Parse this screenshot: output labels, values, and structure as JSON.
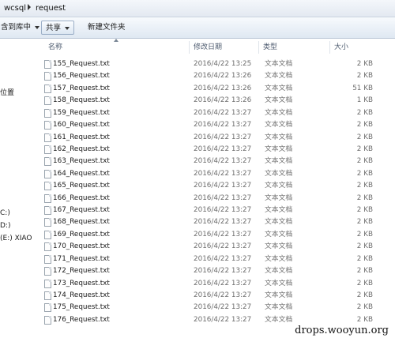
{
  "address": {
    "crumbs": [
      "wcsql",
      "request"
    ]
  },
  "toolbar": {
    "include_label": "含到库中",
    "share_label": "共享",
    "new_folder_label": "新建文件夹"
  },
  "nav": {
    "items": [
      "位置",
      "C:)",
      "D:)",
      "(E:) XIAO"
    ]
  },
  "columns": {
    "name": "名称",
    "date": "修改日期",
    "type": "类型",
    "size": "大小"
  },
  "files": [
    {
      "name": "155_Request.txt",
      "date": "2016/4/22 13:25",
      "type": "文本文档",
      "size": "2 KB"
    },
    {
      "name": "156_Request.txt",
      "date": "2016/4/22 13:26",
      "type": "文本文档",
      "size": "2 KB"
    },
    {
      "name": "157_Request.txt",
      "date": "2016/4/22 13:26",
      "type": "文本文档",
      "size": "51 KB"
    },
    {
      "name": "158_Request.txt",
      "date": "2016/4/22 13:26",
      "type": "文本文档",
      "size": "1 KB"
    },
    {
      "name": "159_Request.txt",
      "date": "2016/4/22 13:27",
      "type": "文本文档",
      "size": "2 KB"
    },
    {
      "name": "160_Request.txt",
      "date": "2016/4/22 13:27",
      "type": "文本文档",
      "size": "2 KB"
    },
    {
      "name": "161_Request.txt",
      "date": "2016/4/22 13:27",
      "type": "文本文档",
      "size": "2 KB"
    },
    {
      "name": "162_Request.txt",
      "date": "2016/4/22 13:27",
      "type": "文本文档",
      "size": "2 KB"
    },
    {
      "name": "163_Request.txt",
      "date": "2016/4/22 13:27",
      "type": "文本文档",
      "size": "2 KB"
    },
    {
      "name": "164_Request.txt",
      "date": "2016/4/22 13:27",
      "type": "文本文档",
      "size": "2 KB"
    },
    {
      "name": "165_Request.txt",
      "date": "2016/4/22 13:27",
      "type": "文本文档",
      "size": "2 KB"
    },
    {
      "name": "166_Request.txt",
      "date": "2016/4/22 13:27",
      "type": "文本文档",
      "size": "2 KB"
    },
    {
      "name": "167_Request.txt",
      "date": "2016/4/22 13:27",
      "type": "文本文档",
      "size": "2 KB"
    },
    {
      "name": "168_Request.txt",
      "date": "2016/4/22 13:27",
      "type": "文本文档",
      "size": "2 KB"
    },
    {
      "name": "169_Request.txt",
      "date": "2016/4/22 13:27",
      "type": "文本文档",
      "size": "2 KB"
    },
    {
      "name": "170_Request.txt",
      "date": "2016/4/22 13:27",
      "type": "文本文档",
      "size": "2 KB"
    },
    {
      "name": "171_Request.txt",
      "date": "2016/4/22 13:27",
      "type": "文本文档",
      "size": "2 KB"
    },
    {
      "name": "172_Request.txt",
      "date": "2016/4/22 13:27",
      "type": "文本文档",
      "size": "2 KB"
    },
    {
      "name": "173_Request.txt",
      "date": "2016/4/22 13:27",
      "type": "文本文档",
      "size": "2 KB"
    },
    {
      "name": "174_Request.txt",
      "date": "2016/4/22 13:27",
      "type": "文本文档",
      "size": "2 KB"
    },
    {
      "name": "175_Request.txt",
      "date": "2016/4/22 13:27",
      "type": "文本文档",
      "size": "2 KB"
    },
    {
      "name": "176_Request.txt",
      "date": "2016/4/22 13:27",
      "type": "文本文档",
      "size": "2 KB"
    }
  ],
  "watermark": "drops.wooyun.org",
  "icons": {
    "file": "text-file-icon",
    "breadcrumb_separator": "chevron-right-icon",
    "dropdown": "chevron-down-icon"
  }
}
